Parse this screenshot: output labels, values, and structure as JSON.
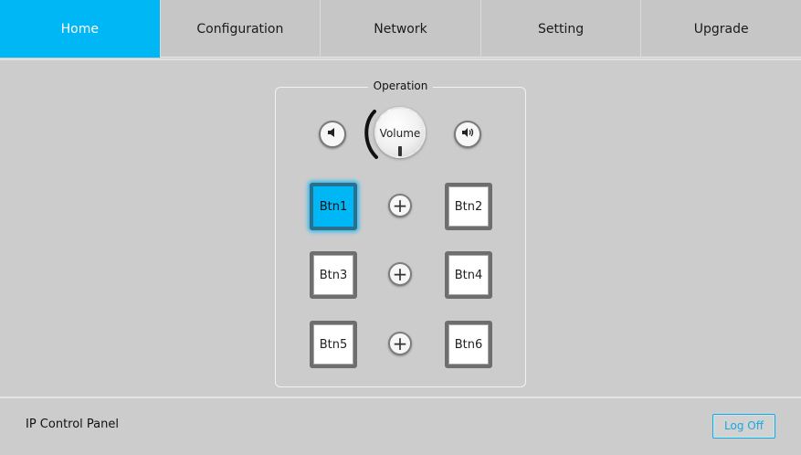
{
  "nav": {
    "tabs": [
      {
        "label": "Home",
        "active": true
      },
      {
        "label": "Configuration",
        "active": false
      },
      {
        "label": "Network",
        "active": false
      },
      {
        "label": "Setting",
        "active": false
      },
      {
        "label": "Upgrade",
        "active": false
      }
    ]
  },
  "operation": {
    "title": "Operation",
    "volume_label": "Volume",
    "volume_down_icon": "speaker-low-icon",
    "volume_up_icon": "speaker-high-icon",
    "buttons": [
      "Btn1",
      "Btn2",
      "Btn3",
      "Btn4",
      "Btn5",
      "Btn6"
    ],
    "active_button": "Btn1",
    "plus_symbol": "+"
  },
  "footer": {
    "title": "IP Control Panel",
    "logoff_label": "Log Off"
  },
  "colors": {
    "accent": "#00b7f5",
    "background": "#cccccc"
  }
}
